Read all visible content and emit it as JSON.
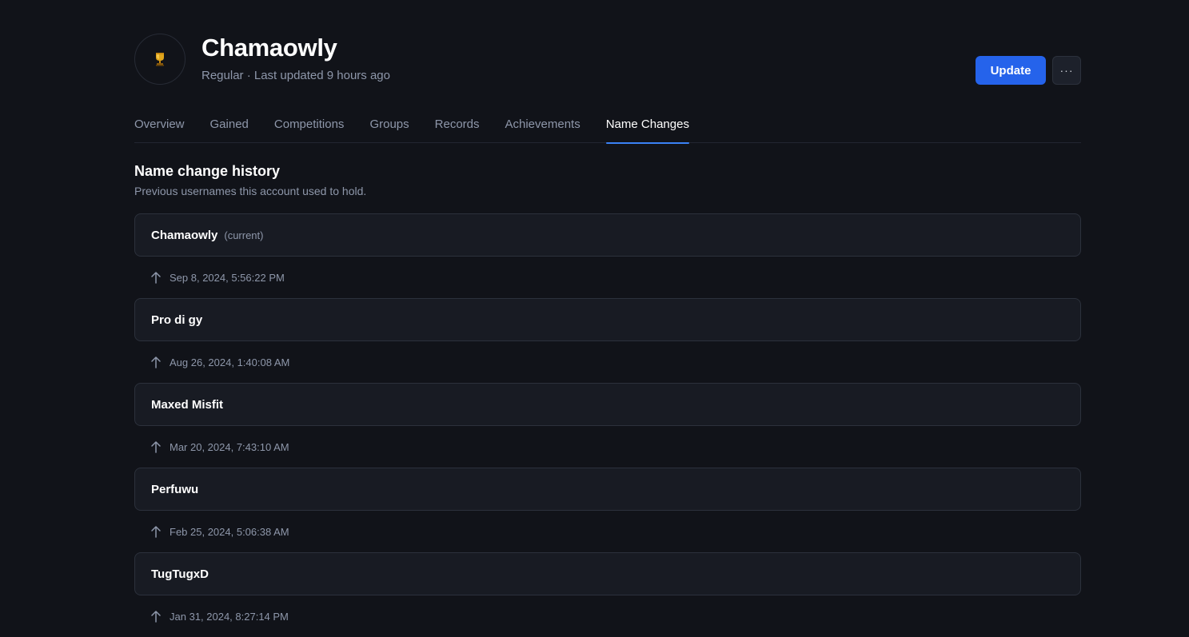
{
  "profile": {
    "name": "Chamaowly",
    "subtitle": "Regular · Last updated 9 hours ago",
    "avatar_icon": "trophy-icon"
  },
  "actions": {
    "update_label": "Update",
    "more_label": "···"
  },
  "tabs": [
    {
      "label": "Overview",
      "active": false
    },
    {
      "label": "Gained",
      "active": false
    },
    {
      "label": "Competitions",
      "active": false
    },
    {
      "label": "Groups",
      "active": false
    },
    {
      "label": "Records",
      "active": false
    },
    {
      "label": "Achievements",
      "active": false
    },
    {
      "label": "Name Changes",
      "active": true
    }
  ],
  "section": {
    "title": "Name change history",
    "description": "Previous usernames this account used to hold."
  },
  "name_history": [
    {
      "name": "Chamaowly",
      "tag": "(current)",
      "changed_at": "Sep 8, 2024, 5:56:22 PM"
    },
    {
      "name": "Pro di gy",
      "tag": "",
      "changed_at": "Aug 26, 2024, 1:40:08 AM"
    },
    {
      "name": "Maxed Misfit",
      "tag": "",
      "changed_at": "Mar 20, 2024, 7:43:10 AM"
    },
    {
      "name": "Perfuwu",
      "tag": "",
      "changed_at": "Feb 25, 2024, 5:06:38 AM"
    },
    {
      "name": "TugTugxD",
      "tag": "",
      "changed_at": "Jan 31, 2024, 8:27:14 PM"
    }
  ],
  "colors": {
    "accent": "#2563eb",
    "tab_indicator": "#3b82f6",
    "background": "#111319",
    "card": "#181b23"
  }
}
